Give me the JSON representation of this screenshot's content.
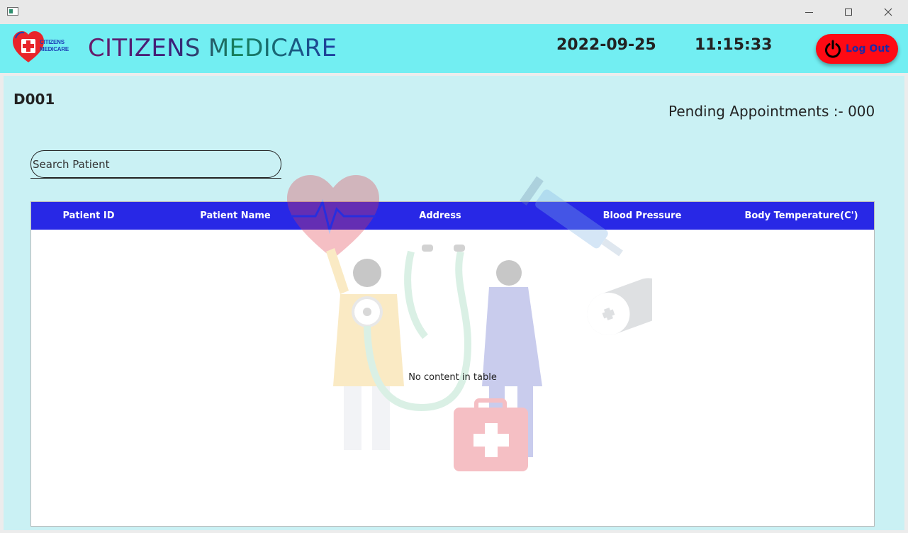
{
  "window": {
    "controls": {
      "minimize": "minimize",
      "maximize": "maximize",
      "close": "close"
    }
  },
  "header": {
    "logo_text_line1": "CITIZENS",
    "logo_text_line2": "MEDICARE",
    "app_title": "CITIZENS MEDICARE",
    "date": "2022-09-25",
    "time": "11:15:33",
    "logout_label": "Log Out",
    "colors": {
      "bar": "#72eef2",
      "logout": "#ff0a14"
    }
  },
  "main": {
    "doctor_id": "D001",
    "pending_appointments": "Pending Appointments :- 000",
    "search": {
      "placeholder": "Search Patient",
      "value": ""
    },
    "table": {
      "columns": [
        "Patient ID",
        "Patient Name",
        "Address",
        "Blood Pressure",
        "Body Temperature(C')"
      ],
      "rows": [],
      "empty_message": "No content in table",
      "header_color": "#2828e6"
    }
  }
}
